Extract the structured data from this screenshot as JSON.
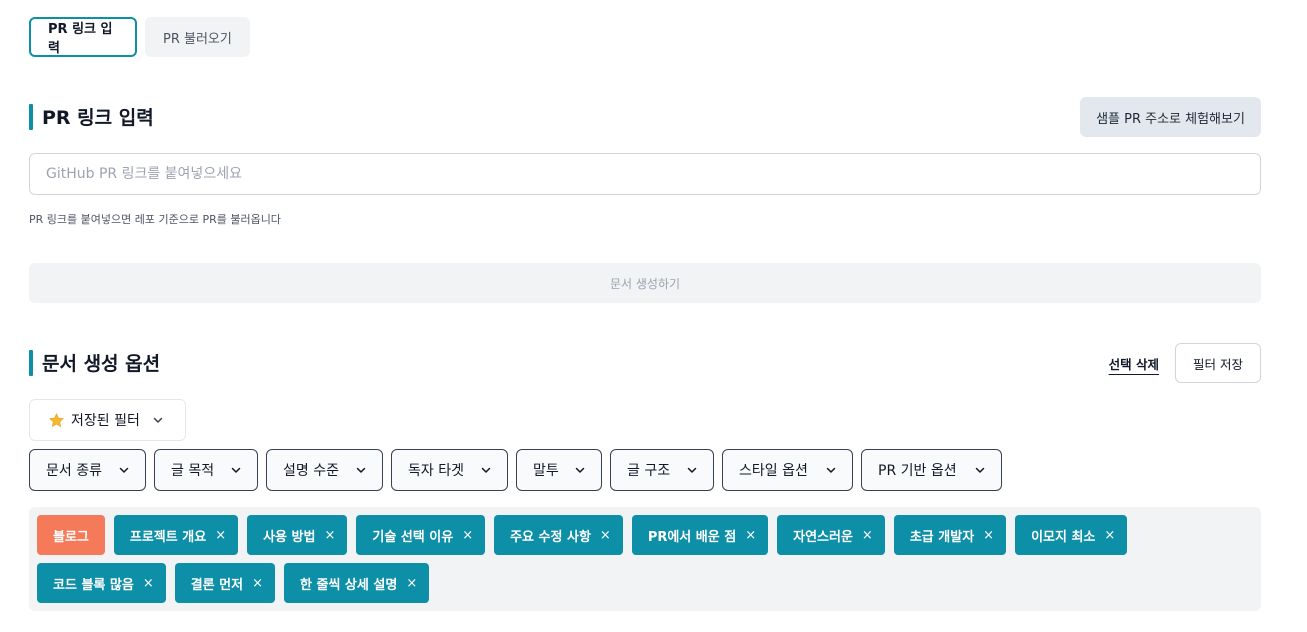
{
  "tabs": [
    {
      "label": "PR 링크 입력",
      "active": true
    },
    {
      "label": "PR 불러오기",
      "active": false
    }
  ],
  "link_section": {
    "title": "PR 링크 입력",
    "sample_button": "샘플 PR 주소로 체험해보기",
    "input_placeholder": "GitHub PR 링크를 붙여넣으세요",
    "input_value": "",
    "helper_text": "PR 링크를 붙여넣으면 레포 기준으로 PR를 불러옵니다",
    "generate_button": "문서 생성하기"
  },
  "options_section": {
    "title": "문서 생성 옵션",
    "delete_selected": "선택 삭제",
    "save_filter": "필터 저장",
    "saved_filters": {
      "label": "저장된 필터",
      "icon": "star-icon"
    },
    "dropdowns": [
      "문서 종류",
      "글 목적",
      "설명 수준",
      "독자 타겟",
      "말투",
      "글 구조",
      "스타일 옵션",
      "PR 기반 옵션"
    ],
    "tags": [
      {
        "label": "블로그",
        "removable": false
      },
      {
        "label": "프로젝트 개요",
        "removable": true
      },
      {
        "label": "사용 방법",
        "removable": true
      },
      {
        "label": "기술 선택 이유",
        "removable": true
      },
      {
        "label": "주요 수정 사항",
        "removable": true
      },
      {
        "label": "PR에서 배운 점",
        "removable": true
      },
      {
        "label": "자연스러운",
        "removable": true
      },
      {
        "label": "초급 개발자",
        "removable": true
      },
      {
        "label": "이모지 최소",
        "removable": true
      },
      {
        "label": "코드 블록 많음",
        "removable": true
      },
      {
        "label": "결론 먼저",
        "removable": true
      },
      {
        "label": "한 줄씩 상세 설명",
        "removable": true
      }
    ],
    "remove_glyph": "×"
  },
  "colors": {
    "accent": "#0e8fa8",
    "primary_tag": "#f47a5a",
    "muted_bg": "#f1f3f5"
  }
}
